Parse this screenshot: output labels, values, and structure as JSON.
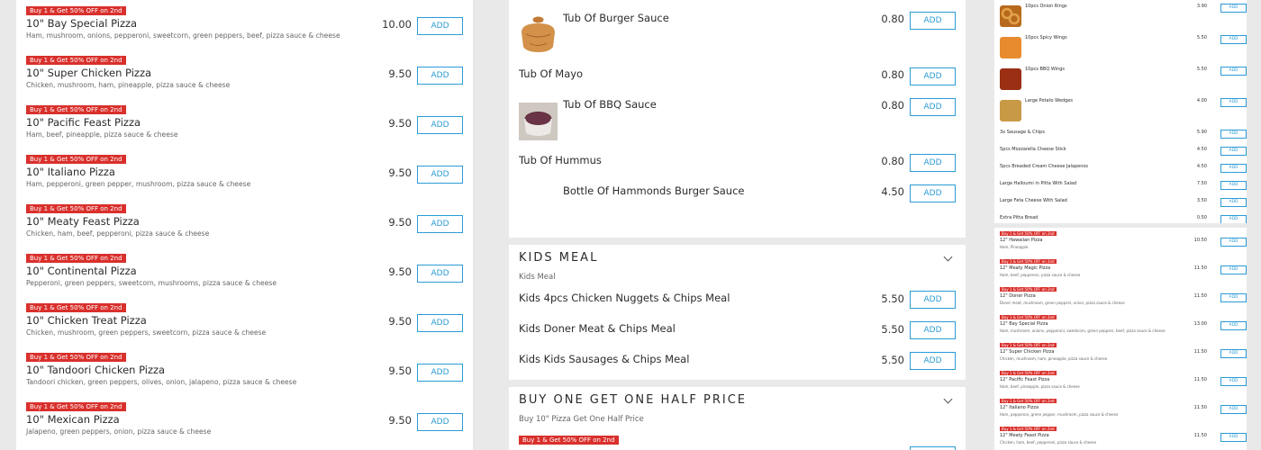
{
  "left_items": [
    {
      "badge": "Buy 1 & Get 50% OFF on 2nd",
      "name": "10\" Bay Special Pizza",
      "desc": "Ham, mushroom, onions, pepperoni, sweetcorn, green peppers, beef, pizza sauce & cheese",
      "price": "10.00",
      "add": "ADD"
    },
    {
      "badge": "Buy 1 & Get 50% OFF on 2nd",
      "name": "10\" Super Chicken Pizza",
      "desc": "Chicken, mushroom, ham, pineapple, pizza sauce & cheese",
      "price": "9.50",
      "add": "ADD"
    },
    {
      "badge": "Buy 1 & Get 50% OFF on 2nd",
      "name": "10\" Pacific Feast Pizza",
      "desc": "Ham, beef, pineapple, pizza sauce & cheese",
      "price": "9.50",
      "add": "ADD"
    },
    {
      "badge": "Buy 1 & Get 50% OFF on 2nd",
      "name": "10\" Italiano Pizza",
      "desc": "Ham, pepperoni, green pepper, mushroom, pizza sauce & cheese",
      "price": "9.50",
      "add": "ADD"
    },
    {
      "badge": "Buy 1 & Get 50% OFF on 2nd",
      "name": "10\" Meaty Feast Pizza",
      "desc": "Chicken, ham, beef, pepperoni, pizza sauce & cheese",
      "price": "9.50",
      "add": "ADD"
    },
    {
      "badge": "Buy 1 & Get 50% OFF on 2nd",
      "name": "10\" Continental Pizza",
      "desc": "Pepperoni, green peppers, sweetcorn, mushrooms, pizza sauce & cheese",
      "price": "9.50",
      "add": "ADD"
    },
    {
      "badge": "Buy 1 & Get 50% OFF on 2nd",
      "name": "10\" Chicken Treat Pizza",
      "desc": "Chicken, mushroom, green peppers, sweetcorn, pizza sauce & cheese",
      "price": "9.50",
      "add": "ADD"
    },
    {
      "badge": "Buy 1 & Get 50% OFF on 2nd",
      "name": "10\" Tandoori Chicken Pizza",
      "desc": "Tandoori chicken, green peppers, olives, onion, jalapeno, pizza sauce & cheese",
      "price": "9.50",
      "add": "ADD"
    },
    {
      "badge": "Buy 1 & Get 50% OFF on 2nd",
      "name": "10\" Mexican Pizza",
      "desc": "Jalapeno, green peppers, onion, pizza sauce & cheese",
      "price": "9.50",
      "add": "ADD"
    }
  ],
  "sauces": [
    {
      "name": "Tub Of Burger Sauce",
      "price": "0.80",
      "add": "ADD"
    },
    {
      "name": "Tub Of Mayo",
      "price": "0.80",
      "add": "ADD"
    },
    {
      "name": "Tub Of BBQ Sauce",
      "price": "0.80",
      "add": "ADD"
    },
    {
      "name": "Tub Of Hummus",
      "price": "0.80",
      "add": "ADD"
    },
    {
      "name": "Bottle Of Hammonds Burger Sauce",
      "price": "4.50",
      "add": "ADD"
    }
  ],
  "kids": {
    "title": "KIDS MEAL",
    "subtitle": "Kids Meal",
    "items": [
      {
        "name": "Kids 4pcs Chicken Nuggets & Chips Meal",
        "price": "5.50",
        "add": "ADD"
      },
      {
        "name": "Kids Doner Meat & Chips Meal",
        "price": "5.50",
        "add": "ADD"
      },
      {
        "name": "Kids Kids Sausages & Chips Meal",
        "price": "5.50",
        "add": "ADD"
      }
    ]
  },
  "bogo": {
    "title": "BUY ONE GET ONE HALF PRICE",
    "subtitle": "Buy 10\" Pizza Get One Half Price",
    "badge": "Buy 1 & Get 50% OFF on 2nd"
  },
  "sides": [
    {
      "name": "10pcs Onion Rings",
      "price": "3.90",
      "add": "ADD"
    },
    {
      "name": "10pcs Spicy Wings",
      "price": "5.50",
      "add": "ADD"
    },
    {
      "name": "10pcs BBQ Wings",
      "price": "5.50",
      "add": "ADD"
    },
    {
      "name": "Large Potato Wedges",
      "price": "4.00",
      "add": "ADD"
    },
    {
      "name": "3x Sausage & Chips",
      "price": "5.90",
      "add": "ADD"
    },
    {
      "name": "5pcs Mozzarella Cheese Stick",
      "price": "4.50",
      "add": "ADD"
    },
    {
      "name": "5pcs Breaded Cream Cheese Jalapenos",
      "price": "4.50",
      "add": "ADD"
    },
    {
      "name": "Large Halloumi in Pitta With Salad",
      "price": "7.50",
      "add": "ADD"
    },
    {
      "name": "Large Feta Cheese With Salad",
      "price": "3.50",
      "add": "ADD"
    },
    {
      "name": "Extra Pitta Bread",
      "price": "0.50",
      "add": "ADD"
    }
  ],
  "pizzas12": [
    {
      "badge": "Buy 1 & Get 50% OFF on 2nd",
      "name": "12\" Hawaiian Pizza",
      "desc": "Ham, Pineapple",
      "price": "10.50",
      "add": "ADD"
    },
    {
      "badge": "Buy 1 & Get 50% OFF on 2nd",
      "name": "12\" Meaty Magic Pizza",
      "desc": "Ham, beef, pepperoni, pizza sauce & cheese",
      "price": "11.50",
      "add": "ADD"
    },
    {
      "badge": "Buy 1 & Get 50% OFF on 2nd",
      "name": "12\" Doner Pizza",
      "desc": "Doner meat, mushroom, green peppers, onion, pizza sauce & cheese",
      "price": "11.50",
      "add": "ADD"
    },
    {
      "badge": "Buy 1 & Get 50% OFF on 2nd",
      "name": "12\" Bay Special Pizza",
      "desc": "Ham, mushroom, onions, pepperoni, sweetcorn, green peppers, beef, pizza sauce & cheese",
      "price": "13.00",
      "add": "ADD"
    },
    {
      "badge": "Buy 1 & Get 50% OFF on 2nd",
      "name": "12\" Super Chicken Pizza",
      "desc": "Chicken, mushroom, ham, pineapple, pizza sauce & cheese",
      "price": "11.50",
      "add": "ADD"
    },
    {
      "badge": "Buy 1 & Get 50% OFF on 2nd",
      "name": "12\" Pacific Feast Pizza",
      "desc": "Ham, beef, pineapple, pizza sauce & cheese",
      "price": "11.50",
      "add": "ADD"
    },
    {
      "badge": "Buy 1 & Get 50% OFF on 2nd",
      "name": "12\" Italiano Pizza",
      "desc": "Ham, pepperoni, green pepper, mushroom, pizza sauce & cheese",
      "price": "11.50",
      "add": "ADD"
    },
    {
      "badge": "Buy 1 & Get 50% OFF on 2nd",
      "name": "12\" Meaty Feast Pizza",
      "desc": "Chicken, ham, beef, pepperoni, pizza sauce & cheese",
      "price": "11.50",
      "add": "ADD"
    }
  ],
  "colors": {
    "badge": "#d9302c",
    "add_button": "#2b9bd6"
  }
}
